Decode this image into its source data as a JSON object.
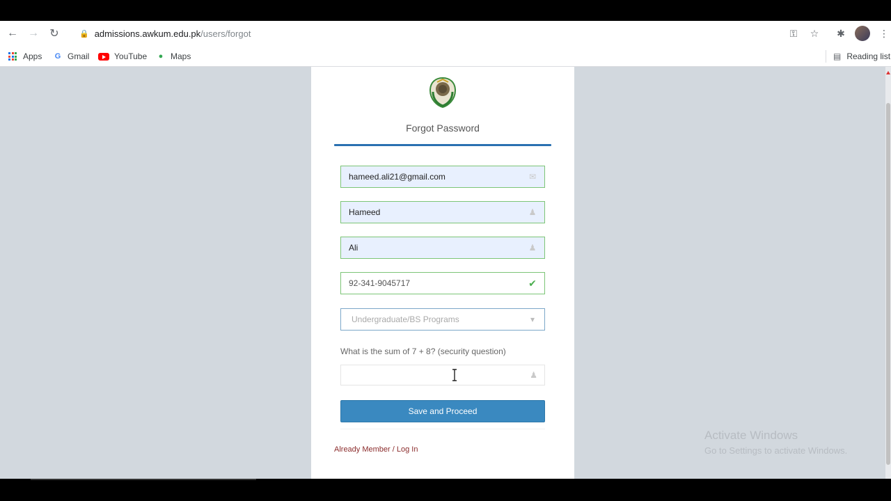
{
  "browser": {
    "url_host": "admissions.awkum.edu.pk",
    "url_path": "/users/forgot",
    "bookmarks": [
      {
        "label": "Apps"
      },
      {
        "label": "Gmail"
      },
      {
        "label": "YouTube"
      },
      {
        "label": "Maps"
      }
    ],
    "reading_list": "Reading list"
  },
  "form": {
    "title": "Forgot Password",
    "email_value": "hameed.ali21@gmail.com",
    "first_name_value": "Hameed",
    "last_name_value": "Ali",
    "phone_value": "92-341-9045717",
    "program_selected": "Undergraduate/BS Programs",
    "security_question": "What is the sum of 7 + 8? (security question)",
    "security_answer": "",
    "submit_label": "Save and Proceed",
    "footer_link": "Already Member / Log In"
  },
  "watermark": {
    "line1": "Activate Windows",
    "line2": "Go to Settings to activate Windows."
  },
  "colors": {
    "accent": "#3a89c0",
    "valid_border": "#7cc576",
    "page_bg": "#d2d8de"
  }
}
